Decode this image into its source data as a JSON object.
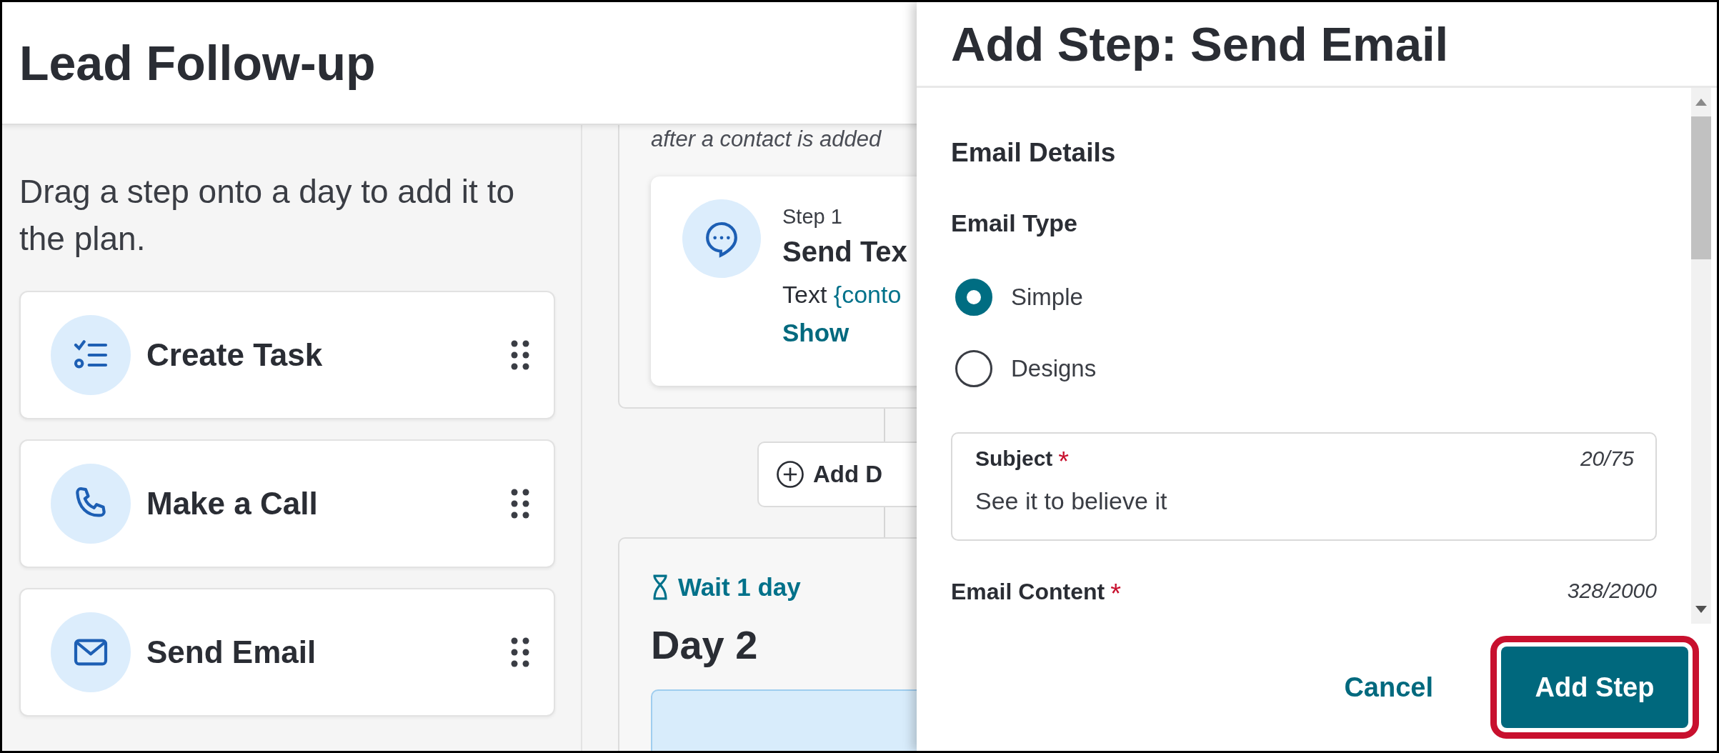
{
  "page": {
    "title": "Lead Follow-up"
  },
  "palette": {
    "hint": "Drag a step onto a day to add it to the plan.",
    "steps": [
      {
        "label": "Create Task",
        "kind": "task"
      },
      {
        "label": "Make a Call",
        "kind": "call"
      },
      {
        "label": "Send Email",
        "kind": "email"
      }
    ]
  },
  "plan": {
    "day1_note": "after a contact is added",
    "step": {
      "kind": "text",
      "number": "Step 1",
      "title": "Send Tex",
      "body_prefix": "Text",
      "body_token": "{conto",
      "link": "Show"
    },
    "add_button": "Add D",
    "day2": {
      "wait": "Wait 1 day",
      "title": "Day 2"
    }
  },
  "drawer": {
    "title": "Add Step: Send Email",
    "section": "Email Details",
    "email_type": {
      "label": "Email Type",
      "options": [
        {
          "label": "Simple",
          "selected": true
        },
        {
          "label": "Designs",
          "selected": false
        }
      ]
    },
    "subject": {
      "label": "Subject",
      "required_mark": "*",
      "count": "20/75",
      "value": "See it to believe it"
    },
    "content": {
      "label": "Email Content",
      "required_mark": "*",
      "count": "328/2000"
    },
    "buttons": [
      {
        "label": "Cancel",
        "kind": "text",
        "highlighted": false
      },
      {
        "label": "Add Step",
        "kind": "primary",
        "highlighted": true
      }
    ]
  }
}
